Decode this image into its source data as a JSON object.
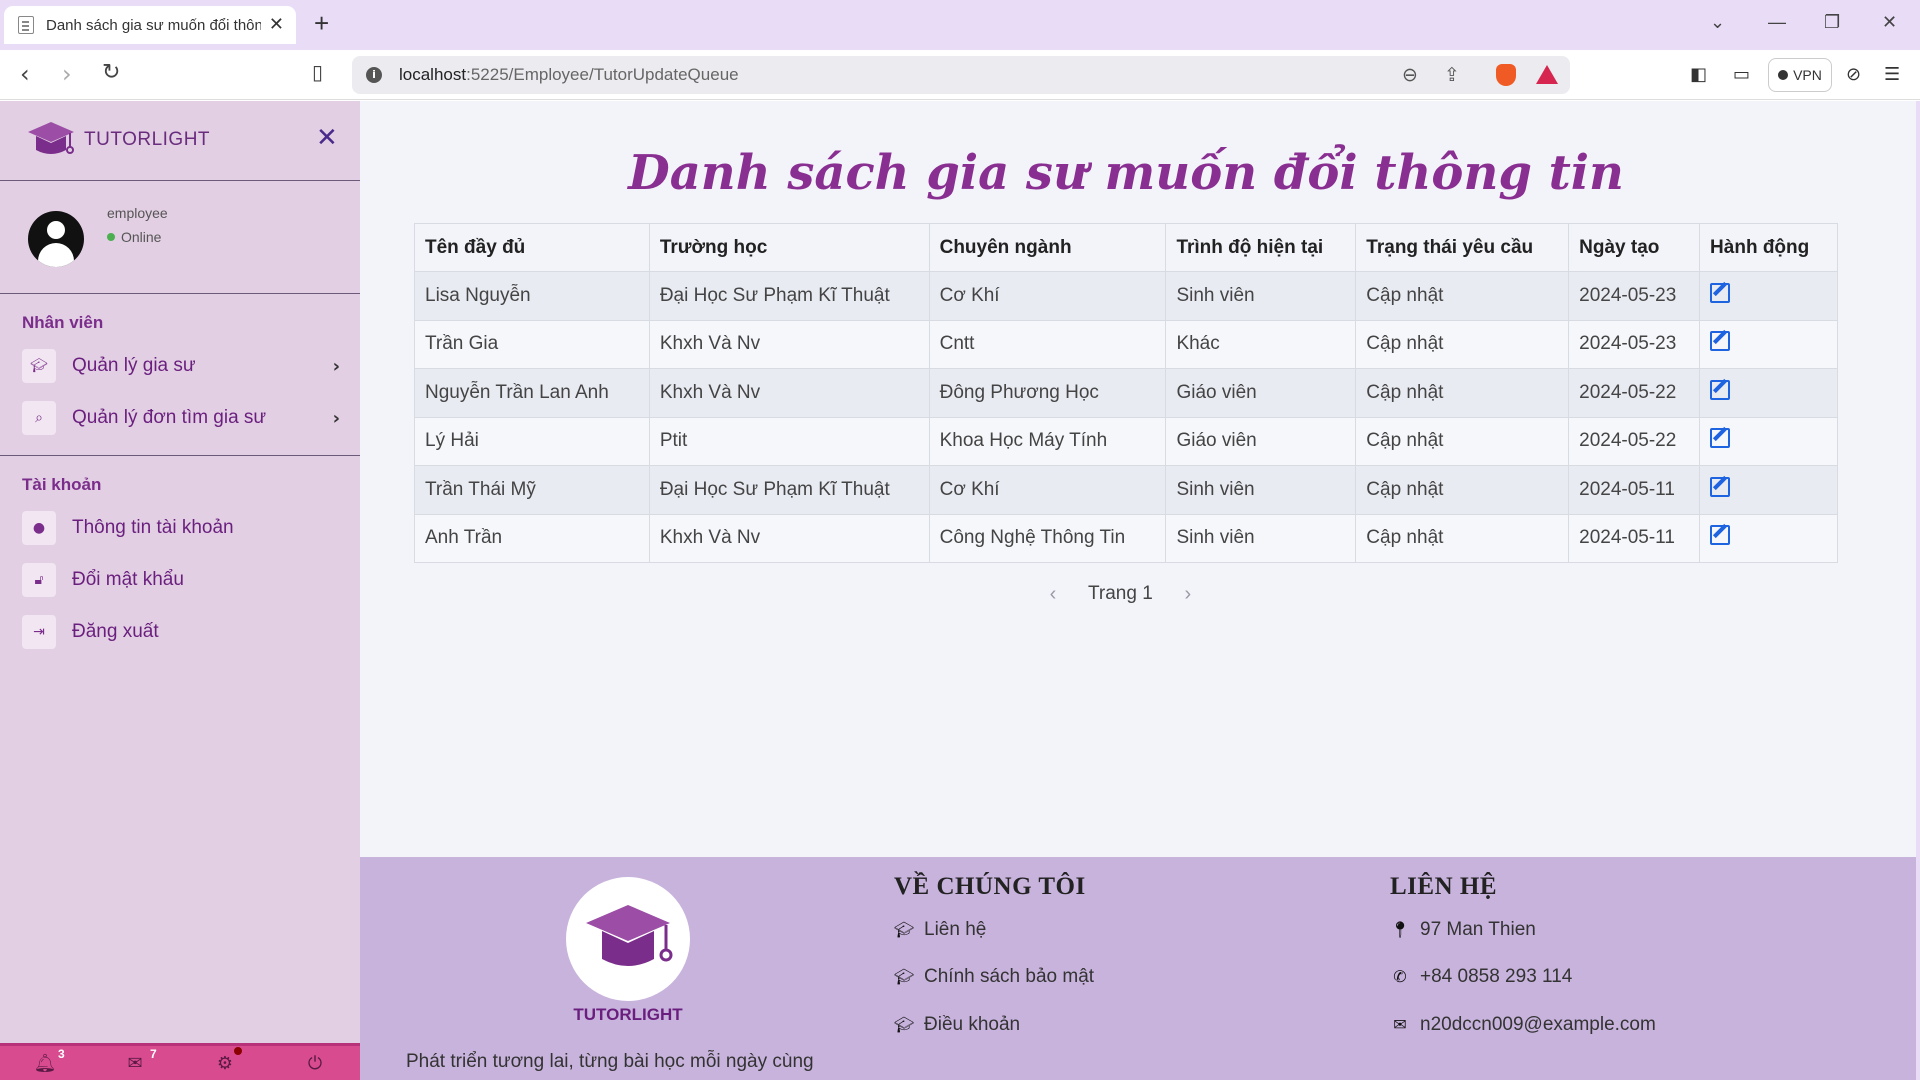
{
  "browser": {
    "tab_title": "Danh sách gia sư muốn đổi thông",
    "url_host": "localhost",
    "url_path": ":5225/Employee/TutorUpdateQueue",
    "vpn_label": "VPN"
  },
  "sidebar": {
    "brand": "TUTORLIGHT",
    "user_role": "employee",
    "user_status": "Online",
    "section_staff": "Nhân viên",
    "section_account": "Tài khoản",
    "nav": [
      {
        "label": "Quản lý gia sư",
        "icon": "graduation-cap-icon"
      },
      {
        "label": "Quản lý đơn tìm gia sư",
        "icon": "search-icon"
      }
    ],
    "account": [
      {
        "label": "Thông tin tài khoản",
        "icon": "info-icon"
      },
      {
        "label": "Đổi mật khẩu",
        "icon": "lock-icon"
      },
      {
        "label": "Đăng xuất",
        "icon": "sign-out-icon"
      }
    ],
    "bottom": {
      "notifications": "3",
      "messages": "7"
    }
  },
  "main": {
    "title": "Danh sách gia sư muốn đổi thông tin",
    "columns": [
      "Tên đầy đủ",
      "Trường học",
      "Chuyên ngành",
      "Trình độ hiện tại",
      "Trạng thái yêu cầu",
      "Ngày tạo",
      "Hành động"
    ],
    "rows": [
      [
        "Lisa Nguyễn",
        "Đại Học Sư Phạm Kĩ Thuật",
        "Cơ Khí",
        "Sinh viên",
        "Cập nhật",
        "2024-05-23"
      ],
      [
        "Trần Gia",
        "Khxh Và Nv",
        "Cntt",
        "Khác",
        "Cập nhật",
        "2024-05-23"
      ],
      [
        "Nguyễn Trần Lan Anh",
        "Khxh Và Nv",
        "Đông Phương Học",
        "Giáo viên",
        "Cập nhật",
        "2024-05-22"
      ],
      [
        "Lý Hải",
        "Ptit",
        "Khoa Học Máy Tính",
        "Giáo viên",
        "Cập nhật",
        "2024-05-22"
      ],
      [
        "Trần Thái Mỹ",
        "Đại Học Sư Phạm Kĩ Thuật",
        "Cơ Khí",
        "Sinh viên",
        "Cập nhật",
        "2024-05-11"
      ],
      [
        "Anh Trần",
        "Khxh Và Nv",
        "Công Nghệ Thông Tin",
        "Sinh viên",
        "Cập nhật",
        "2024-05-11"
      ]
    ],
    "pager_label": "Trang 1"
  },
  "footer": {
    "brand": "TUTORLIGHT",
    "tagline": "Phát triển tương lai, từng bài học mỗi ngày cùng",
    "about_heading": "VỀ CHÚNG TÔI",
    "about_items": [
      "Liên hệ",
      "Chính sách bảo mật",
      "Điều khoản"
    ],
    "contact_heading": "LIÊN HỆ",
    "address": "97 Man Thien",
    "phone": "+84 0858 293 114",
    "email": "n20dccn009@example.com"
  },
  "colors": {
    "accent": "#8a2f92",
    "sidebar_bg": "#e2cfe3",
    "footer_bg": "#c8b3dd",
    "bottom_bar": "#d94b8f",
    "edit_icon": "#1e63e0"
  }
}
